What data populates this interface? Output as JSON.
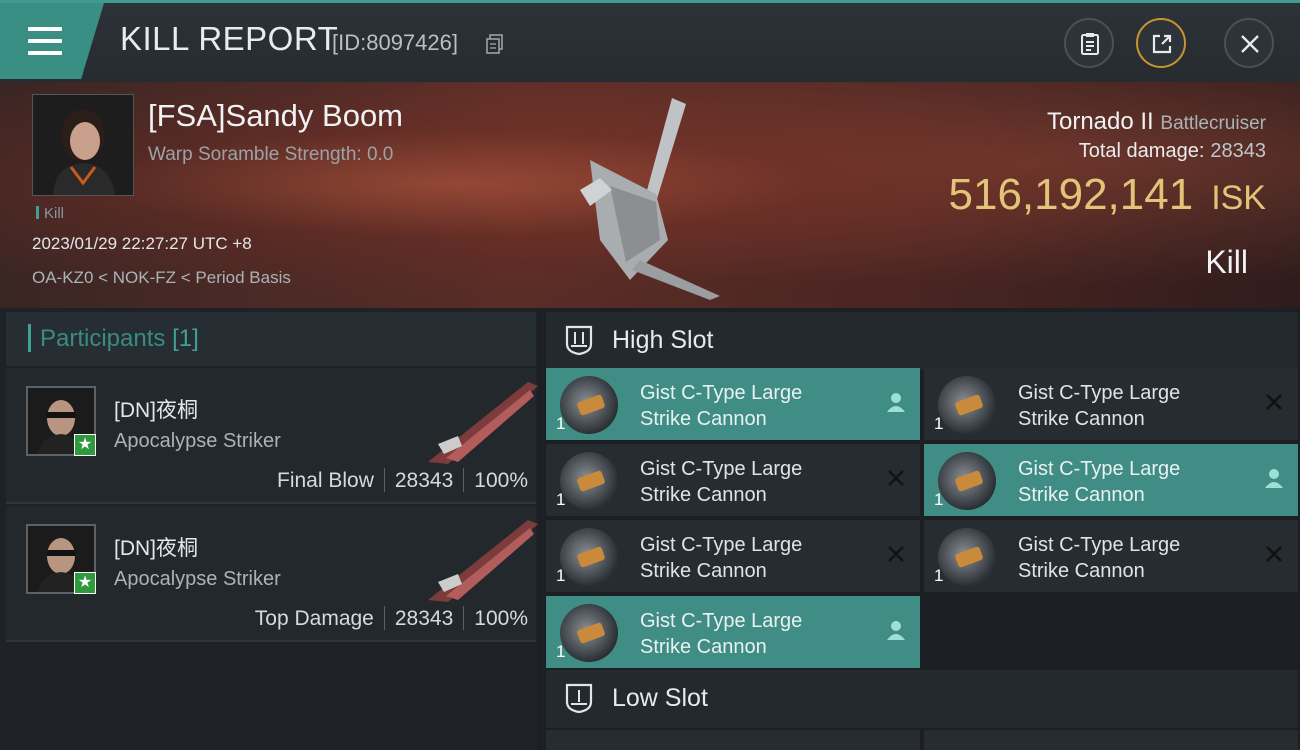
{
  "window": {
    "title": "KILL REPORT",
    "report_id": "[ID:8097426]",
    "buttons": [
      "menu-icon",
      "clipboard-icon",
      "share-icon",
      "close-icon"
    ]
  },
  "victim": {
    "name": "[FSA]Sandy Boom",
    "warp_scramble": "Warp Soramble Strength: 0.0",
    "tag": "Kill",
    "datetime": "2023/01/29 22:27:27 UTC +8",
    "location": "OA-KZ0 < NOK-FZ < Period Basis",
    "ship_name": "Tornado II",
    "ship_class": "Battlecruiser",
    "total_damage_label": "Total damage:",
    "total_damage_value": "28343",
    "isk_value": "516,192,141",
    "isk_unit": "ISK",
    "result": "Kill"
  },
  "participants": {
    "title": "Participants",
    "count": "[1]",
    "rows": [
      {
        "name": "[DN]夜桐",
        "ship": "Apocalypse Striker",
        "role": "Final Blow",
        "damage": "28343",
        "percent": "100%"
      },
      {
        "name": "[DN]夜桐",
        "ship": "Apocalypse Striker",
        "role": "Top Damage",
        "damage": "28343",
        "percent": "100%"
      }
    ]
  },
  "slots": {
    "high": {
      "label": "High Slot",
      "modules": [
        {
          "line1": "Gist C-Type Large",
          "line2": "Strike Cannon",
          "qty": "1",
          "state": "pilot-icon",
          "active": true
        },
        {
          "line1": "Gist C-Type Large",
          "line2": "Strike Cannon",
          "qty": "1",
          "state": "destroyed-x-icon",
          "active": false
        },
        {
          "line1": "Gist C-Type Large",
          "line2": "Strike Cannon",
          "qty": "1",
          "state": "destroyed-x-icon",
          "active": false
        },
        {
          "line1": "Gist C-Type Large",
          "line2": "Strike Cannon",
          "qty": "1",
          "state": "pilot-icon",
          "active": true
        },
        {
          "line1": "Gist C-Type Large",
          "line2": "Strike Cannon",
          "qty": "1",
          "state": "destroyed-x-icon",
          "active": false
        },
        {
          "line1": "Gist C-Type Large",
          "line2": "Strike Cannon",
          "qty": "1",
          "state": "destroyed-x-icon",
          "active": false
        },
        {
          "line1": "Gist C-Type Large",
          "line2": "Strike Cannon",
          "qty": "1",
          "state": "pilot-icon",
          "active": true
        }
      ]
    },
    "low": {
      "label": "Low Slot"
    }
  },
  "colors": {
    "accent": "#3f9a8f",
    "isk_gold": "#e2c479",
    "active_module": "#3f8d84"
  }
}
